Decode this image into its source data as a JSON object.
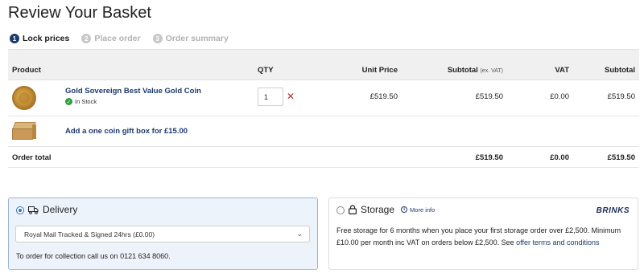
{
  "page": {
    "title": "Review Your Basket"
  },
  "steps": [
    {
      "num": "1",
      "label": "Lock prices"
    },
    {
      "num": "2",
      "label": "Place order"
    },
    {
      "num": "3",
      "label": "Order summary"
    }
  ],
  "table": {
    "headers": {
      "product": "Product",
      "qty": "QTY",
      "unit_price": "Unit Price",
      "subtotal_ex": "Subtotal",
      "subtotal_ex_note": "(ex. VAT)",
      "vat": "VAT",
      "subtotal": "Subtotal"
    },
    "items": [
      {
        "name": "Gold Sovereign Best Value Gold Coin",
        "stock": "In Stock",
        "qty": "1",
        "unit_price": "£519.50",
        "subtotal_ex": "£519.50",
        "vat": "£0.00",
        "subtotal": "£519.50"
      }
    ],
    "gift_box": {
      "label": "Add a one coin gift box for £15.00"
    },
    "total": {
      "label": "Order total",
      "subtotal_ex": "£519.50",
      "vat": "£0.00",
      "subtotal": "£519.50"
    }
  },
  "delivery": {
    "title": "Delivery",
    "selected_option": "Royal Mail Tracked & Signed 24hrs (£0.00)",
    "note": "To order for collection call us on 0121 634 8060."
  },
  "storage": {
    "title": "Storage",
    "more_info": "More info",
    "brand": "BRINKS",
    "text": "Free storage for 6 months when you place your first storage order over £2,500. Minimum £10.00 per month inc VAT on orders below £2,500. See",
    "link": "offer terms and conditions"
  },
  "colors": {
    "accent": "#1d3a6e",
    "remove": "#c0282a",
    "in_stock": "#2e9e3e",
    "delivery_bg": "#edf3fa"
  }
}
